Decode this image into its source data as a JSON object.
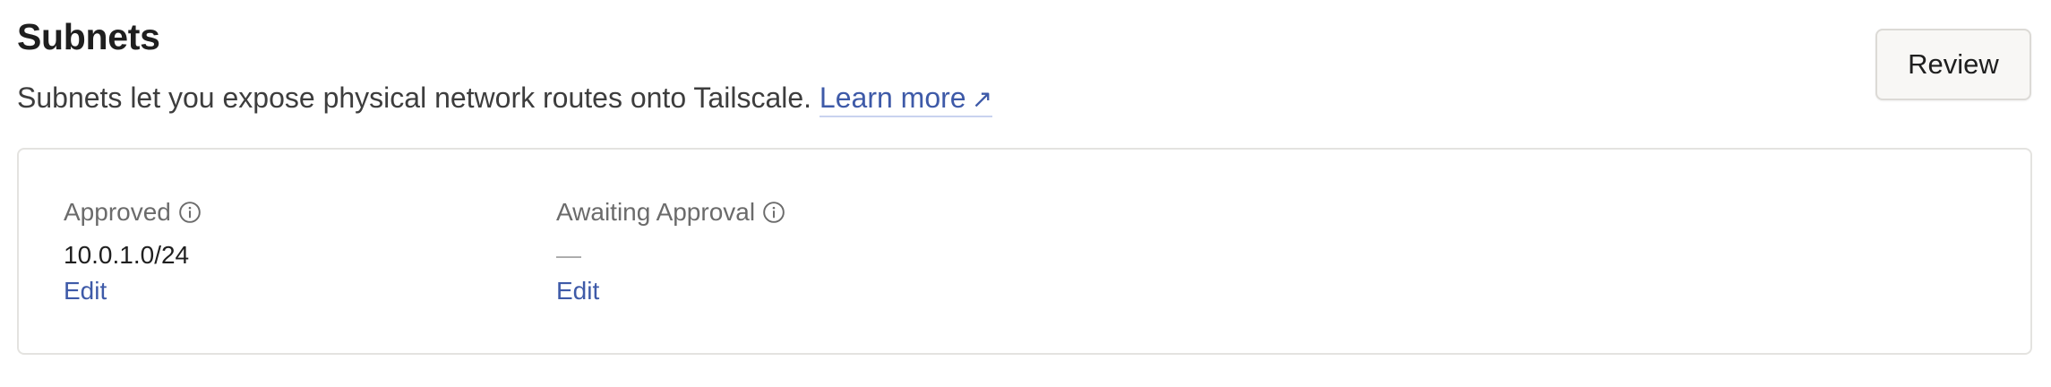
{
  "header": {
    "title": "Subnets",
    "description": "Subnets let you expose physical network routes onto Tailscale.",
    "learn_more_label": "Learn more",
    "learn_more_icon": "external-arrow-icon",
    "review_label": "Review"
  },
  "approved": {
    "label": "Approved",
    "info_icon": "info-icon",
    "value": "10.0.1.0/24",
    "edit_label": "Edit"
  },
  "awaiting": {
    "label": "Awaiting Approval",
    "info_icon": "info-icon",
    "value": "—",
    "edit_label": "Edit"
  },
  "colors": {
    "link": "#3e5aa8",
    "muted_text": "#6b6b6b",
    "border": "#e4e3e0",
    "button_bg": "#f8f7f5"
  }
}
